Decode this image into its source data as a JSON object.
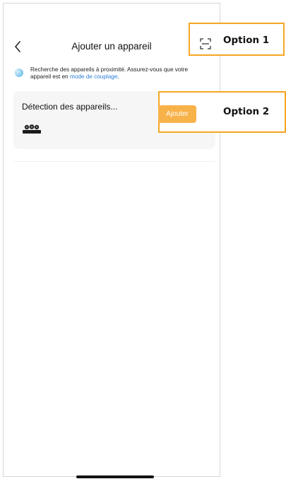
{
  "header": {
    "title": "Ajouter un appareil",
    "back_icon": "chevron-left-icon",
    "scan_icon": "qr-scan-icon"
  },
  "hint": {
    "text": "Recherche des appareils à proximité. Assurez-vous que votre appareil est en ",
    "link": "mode de couplage",
    "suffix": "."
  },
  "card": {
    "title": "Détection des appareils...",
    "device_icon": "device-thumbnail-icon",
    "button_label": "Ajouter"
  },
  "callouts": {
    "option1": "Option 1",
    "option2": "Option 2"
  },
  "colors": {
    "accent": "#f8b24a",
    "link": "#2d7fd8",
    "callout_border": "#f5a623"
  }
}
